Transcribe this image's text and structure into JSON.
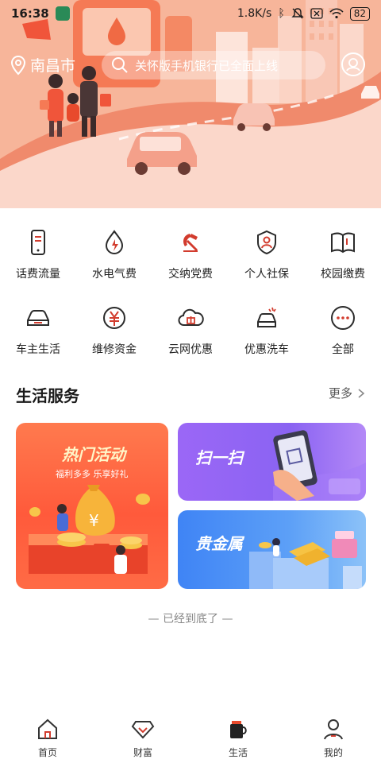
{
  "status_bar": {
    "time": "16:38",
    "speed": "1.8K/s",
    "battery": "82"
  },
  "header": {
    "city": "南昌市",
    "search_placeholder": "关怀版手机银行已全面上线"
  },
  "services": [
    {
      "label": "话费流量",
      "icon": "phone-icon"
    },
    {
      "label": "水电气费",
      "icon": "utility-drop-icon"
    },
    {
      "label": "交纳党费",
      "icon": "party-emblem-icon"
    },
    {
      "label": "个人社保",
      "icon": "social-security-icon"
    },
    {
      "label": "校园缴费",
      "icon": "book-icon"
    },
    {
      "label": "车主生活",
      "icon": "car-icon"
    },
    {
      "label": "维修资金",
      "icon": "yuan-coin-icon"
    },
    {
      "label": "云网优惠",
      "icon": "cloud-gift-icon"
    },
    {
      "label": "优惠洗车",
      "icon": "car-wash-icon"
    },
    {
      "label": "全部",
      "icon": "more-dots-icon"
    }
  ],
  "life_section": {
    "title": "生活服务",
    "more_label": "更多"
  },
  "cards": {
    "hot": {
      "title": "热门活动",
      "subtitle": "福利多多 乐享好礼"
    },
    "scan": {
      "title": "扫一扫"
    },
    "metal": {
      "title": "贵金属"
    }
  },
  "bottom_note": "— 已经到底了 —",
  "tabs": [
    {
      "label": "首页",
      "icon": "home-icon"
    },
    {
      "label": "财富",
      "icon": "diamond-icon"
    },
    {
      "label": "生活",
      "icon": "coffee-cup-icon",
      "active": true
    },
    {
      "label": "我的",
      "icon": "user-icon"
    }
  ],
  "colors": {
    "accent": "#e84a2c",
    "icon_red": "#d23c2e",
    "icon_dark": "#2b2b2b",
    "banner": "#f6a98c"
  }
}
